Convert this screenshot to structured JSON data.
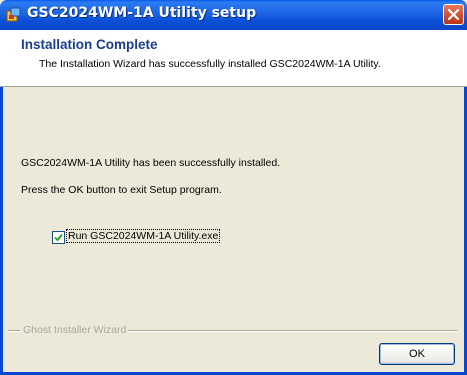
{
  "window": {
    "title": "GSC2024WM-1A Utility setup",
    "icon": "installer-icon",
    "close_icon": "close-icon"
  },
  "header": {
    "title": "Installation Complete",
    "description": "The Installation Wizard has successfully installed GSC2024WM-1A Utility."
  },
  "body": {
    "line1": "GSC2024WM-1A Utility has been successfully installed.",
    "line2": "Press the OK button to exit Setup program.",
    "run_checkbox": {
      "label": "Run GSC2024WM-1A Utility.exe",
      "checked": true
    }
  },
  "footer": {
    "brand": "Ghost Installer Wizard",
    "ok_label": "OK"
  },
  "colors": {
    "titlebar": "#0c4fd6",
    "header_title": "#1a3e8c",
    "dialog_bg": "#ece9d8",
    "close_button": "#cf4a2a"
  }
}
